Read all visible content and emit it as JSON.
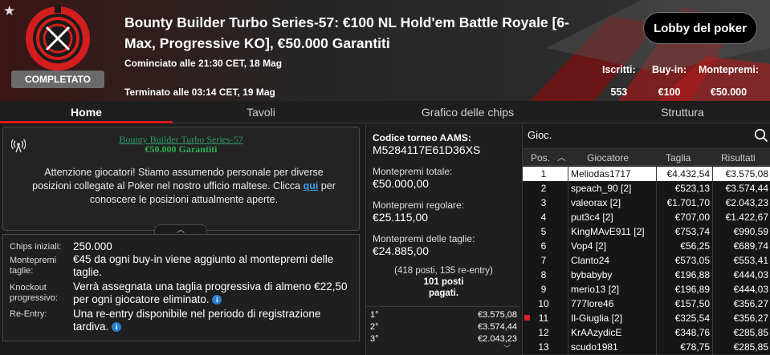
{
  "header": {
    "title": "Bounty Builder Turbo Series-57: €100 NL Hold'em Battle Royale [6-Max, Progressive KO], €50.000 Garantiti",
    "status": "COMPLETATO",
    "started": "Cominciato alle 21:30 CET, 18 Mag",
    "ended": "Terminato alle 03:14 CET, 19 Mag",
    "lobby_button": "Lobby del poker",
    "stats": [
      {
        "label": "Iscritti:",
        "value": "553"
      },
      {
        "label": "Buy-in:",
        "value": "€100"
      },
      {
        "label": "Montepremi:",
        "value": "€50.000"
      }
    ]
  },
  "tabs": [
    {
      "label": "Home",
      "active": true
    },
    {
      "label": "Tavoli",
      "active": false
    },
    {
      "label": "Grafico delle chips",
      "active": false
    },
    {
      "label": "Struttura",
      "active": false
    }
  ],
  "notice": {
    "title": "Bounty Builder Turbo Series-57",
    "subtitle": "€50.000 Garantiti",
    "body_before": "Attenzione giocatori! Stiamo assumendo personale per diverse posizioni collegate al Poker nel nostro ufficio maltese. Clicca ",
    "link": "qui",
    "body_after": " per conoscere le posizioni attualmente aperte."
  },
  "details": [
    {
      "label": "Chips iniziali:",
      "value": "250.000",
      "info": false
    },
    {
      "label": "Montepremi taglie:",
      "value": "€45 da ogni buy-in viene aggiunto al montepremi delle taglie.",
      "info": false
    },
    {
      "label": "Knockout progressivo:",
      "value": "Verrà assegnata una taglia progressiva di almeno €22,50 per ogni giocatore eliminato.",
      "info": true
    },
    {
      "label": "Re-Entry:",
      "value": "Una re-entry disponibile nel periodo di registrazione tardiva.",
      "info": true
    }
  ],
  "middle": {
    "code_label": "Codice torneo AAMS:",
    "code_value": "M5284117E61D36XS",
    "total_label": "Montepremi totale:",
    "total_value": "€50.000,00",
    "regular_label": "Montepremi regolare:",
    "regular_value": "€25.115,00",
    "bounty_label": "Montepremi delle taglie:",
    "bounty_value": "€24.885,00",
    "seats_line1": "(418 posti, 135 re-entry)",
    "seats_line2": "101 posti",
    "seats_line3": "pagati.",
    "prizes": [
      {
        "pos": "1°",
        "value": "€3.575,08"
      },
      {
        "pos": "2°",
        "value": "€3.574,44"
      },
      {
        "pos": "3°",
        "value": "€2.043,23"
      }
    ]
  },
  "players": {
    "search_label": "Gioc.",
    "columns": [
      "Pos.",
      "Giocatore",
      "Taglia",
      "Risultati"
    ],
    "rows": [
      {
        "pos": "1",
        "name": "Meliodas1717",
        "bounty": "€4.432,54",
        "result": "€3.575,08",
        "selected": true
      },
      {
        "pos": "2",
        "name": "speach_90 [2]",
        "bounty": "€523,13",
        "result": "€3.574,44"
      },
      {
        "pos": "3",
        "name": "valeorax [2]",
        "bounty": "€1.701,70",
        "result": "€2.043,23"
      },
      {
        "pos": "4",
        "name": "put3c4 [2]",
        "bounty": "€707,00",
        "result": "€1.422,67"
      },
      {
        "pos": "5",
        "name": "KingMAvE911 [2]",
        "bounty": "€753,74",
        "result": "€990,59"
      },
      {
        "pos": "6",
        "name": "Vop4 [2]",
        "bounty": "€56,25",
        "result": "€689,74"
      },
      {
        "pos": "7",
        "name": "Clanto24",
        "bounty": "€573,05",
        "result": "€553,41"
      },
      {
        "pos": "8",
        "name": "bybabyby",
        "bounty": "€196,88",
        "result": "€444,03"
      },
      {
        "pos": "9",
        "name": "merio13 [2]",
        "bounty": "€196,89",
        "result": "€444,03"
      },
      {
        "pos": "10",
        "name": "777lore46",
        "bounty": "€157,50",
        "result": "€356,27"
      },
      {
        "pos": "11",
        "name": "Il-Giuglia [2]",
        "bounty": "€325,54",
        "result": "€356,27",
        "flag": true
      },
      {
        "pos": "12",
        "name": "KrAAzydicE",
        "bounty": "€348,76",
        "result": "€285,85"
      },
      {
        "pos": "13",
        "name": "scudo1981",
        "bounty": "€78,75",
        "result": "€285,85"
      }
    ]
  },
  "colors": {
    "accent_red": "#d61b1b",
    "link_blue": "#3aa0e6",
    "notice_green": "#2fae54"
  }
}
